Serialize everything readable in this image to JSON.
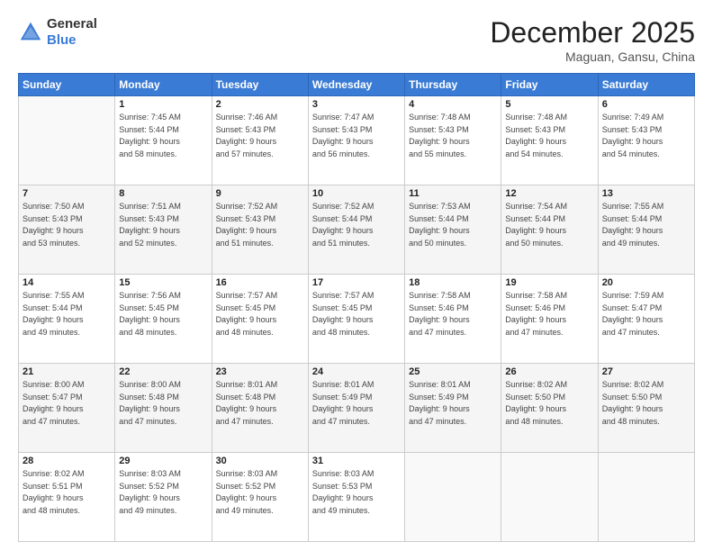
{
  "logo": {
    "line1": "General",
    "line2": "Blue"
  },
  "header": {
    "month": "December 2025",
    "location": "Maguan, Gansu, China"
  },
  "days_of_week": [
    "Sunday",
    "Monday",
    "Tuesday",
    "Wednesday",
    "Thursday",
    "Friday",
    "Saturday"
  ],
  "weeks": [
    [
      {
        "day": "",
        "sunrise": "",
        "sunset": "",
        "daylight": ""
      },
      {
        "day": "1",
        "sunrise": "Sunrise: 7:45 AM",
        "sunset": "Sunset: 5:44 PM",
        "daylight": "Daylight: 9 hours and 58 minutes."
      },
      {
        "day": "2",
        "sunrise": "Sunrise: 7:46 AM",
        "sunset": "Sunset: 5:43 PM",
        "daylight": "Daylight: 9 hours and 57 minutes."
      },
      {
        "day": "3",
        "sunrise": "Sunrise: 7:47 AM",
        "sunset": "Sunset: 5:43 PM",
        "daylight": "Daylight: 9 hours and 56 minutes."
      },
      {
        "day": "4",
        "sunrise": "Sunrise: 7:48 AM",
        "sunset": "Sunset: 5:43 PM",
        "daylight": "Daylight: 9 hours and 55 minutes."
      },
      {
        "day": "5",
        "sunrise": "Sunrise: 7:48 AM",
        "sunset": "Sunset: 5:43 PM",
        "daylight": "Daylight: 9 hours and 54 minutes."
      },
      {
        "day": "6",
        "sunrise": "Sunrise: 7:49 AM",
        "sunset": "Sunset: 5:43 PM",
        "daylight": "Daylight: 9 hours and 54 minutes."
      }
    ],
    [
      {
        "day": "7",
        "sunrise": "Sunrise: 7:50 AM",
        "sunset": "Sunset: 5:43 PM",
        "daylight": "Daylight: 9 hours and 53 minutes."
      },
      {
        "day": "8",
        "sunrise": "Sunrise: 7:51 AM",
        "sunset": "Sunset: 5:43 PM",
        "daylight": "Daylight: 9 hours and 52 minutes."
      },
      {
        "day": "9",
        "sunrise": "Sunrise: 7:52 AM",
        "sunset": "Sunset: 5:43 PM",
        "daylight": "Daylight: 9 hours and 51 minutes."
      },
      {
        "day": "10",
        "sunrise": "Sunrise: 7:52 AM",
        "sunset": "Sunset: 5:44 PM",
        "daylight": "Daylight: 9 hours and 51 minutes."
      },
      {
        "day": "11",
        "sunrise": "Sunrise: 7:53 AM",
        "sunset": "Sunset: 5:44 PM",
        "daylight": "Daylight: 9 hours and 50 minutes."
      },
      {
        "day": "12",
        "sunrise": "Sunrise: 7:54 AM",
        "sunset": "Sunset: 5:44 PM",
        "daylight": "Daylight: 9 hours and 50 minutes."
      },
      {
        "day": "13",
        "sunrise": "Sunrise: 7:55 AM",
        "sunset": "Sunset: 5:44 PM",
        "daylight": "Daylight: 9 hours and 49 minutes."
      }
    ],
    [
      {
        "day": "14",
        "sunrise": "Sunrise: 7:55 AM",
        "sunset": "Sunset: 5:44 PM",
        "daylight": "Daylight: 9 hours and 49 minutes."
      },
      {
        "day": "15",
        "sunrise": "Sunrise: 7:56 AM",
        "sunset": "Sunset: 5:45 PM",
        "daylight": "Daylight: 9 hours and 48 minutes."
      },
      {
        "day": "16",
        "sunrise": "Sunrise: 7:57 AM",
        "sunset": "Sunset: 5:45 PM",
        "daylight": "Daylight: 9 hours and 48 minutes."
      },
      {
        "day": "17",
        "sunrise": "Sunrise: 7:57 AM",
        "sunset": "Sunset: 5:45 PM",
        "daylight": "Daylight: 9 hours and 48 minutes."
      },
      {
        "day": "18",
        "sunrise": "Sunrise: 7:58 AM",
        "sunset": "Sunset: 5:46 PM",
        "daylight": "Daylight: 9 hours and 47 minutes."
      },
      {
        "day": "19",
        "sunrise": "Sunrise: 7:58 AM",
        "sunset": "Sunset: 5:46 PM",
        "daylight": "Daylight: 9 hours and 47 minutes."
      },
      {
        "day": "20",
        "sunrise": "Sunrise: 7:59 AM",
        "sunset": "Sunset: 5:47 PM",
        "daylight": "Daylight: 9 hours and 47 minutes."
      }
    ],
    [
      {
        "day": "21",
        "sunrise": "Sunrise: 8:00 AM",
        "sunset": "Sunset: 5:47 PM",
        "daylight": "Daylight: 9 hours and 47 minutes."
      },
      {
        "day": "22",
        "sunrise": "Sunrise: 8:00 AM",
        "sunset": "Sunset: 5:48 PM",
        "daylight": "Daylight: 9 hours and 47 minutes."
      },
      {
        "day": "23",
        "sunrise": "Sunrise: 8:01 AM",
        "sunset": "Sunset: 5:48 PM",
        "daylight": "Daylight: 9 hours and 47 minutes."
      },
      {
        "day": "24",
        "sunrise": "Sunrise: 8:01 AM",
        "sunset": "Sunset: 5:49 PM",
        "daylight": "Daylight: 9 hours and 47 minutes."
      },
      {
        "day": "25",
        "sunrise": "Sunrise: 8:01 AM",
        "sunset": "Sunset: 5:49 PM",
        "daylight": "Daylight: 9 hours and 47 minutes."
      },
      {
        "day": "26",
        "sunrise": "Sunrise: 8:02 AM",
        "sunset": "Sunset: 5:50 PM",
        "daylight": "Daylight: 9 hours and 48 minutes."
      },
      {
        "day": "27",
        "sunrise": "Sunrise: 8:02 AM",
        "sunset": "Sunset: 5:50 PM",
        "daylight": "Daylight: 9 hours and 48 minutes."
      }
    ],
    [
      {
        "day": "28",
        "sunrise": "Sunrise: 8:02 AM",
        "sunset": "Sunset: 5:51 PM",
        "daylight": "Daylight: 9 hours and 48 minutes."
      },
      {
        "day": "29",
        "sunrise": "Sunrise: 8:03 AM",
        "sunset": "Sunset: 5:52 PM",
        "daylight": "Daylight: 9 hours and 49 minutes."
      },
      {
        "day": "30",
        "sunrise": "Sunrise: 8:03 AM",
        "sunset": "Sunset: 5:52 PM",
        "daylight": "Daylight: 9 hours and 49 minutes."
      },
      {
        "day": "31",
        "sunrise": "Sunrise: 8:03 AM",
        "sunset": "Sunset: 5:53 PM",
        "daylight": "Daylight: 9 hours and 49 minutes."
      },
      {
        "day": "",
        "sunrise": "",
        "sunset": "",
        "daylight": ""
      },
      {
        "day": "",
        "sunrise": "",
        "sunset": "",
        "daylight": ""
      },
      {
        "day": "",
        "sunrise": "",
        "sunset": "",
        "daylight": ""
      }
    ]
  ]
}
